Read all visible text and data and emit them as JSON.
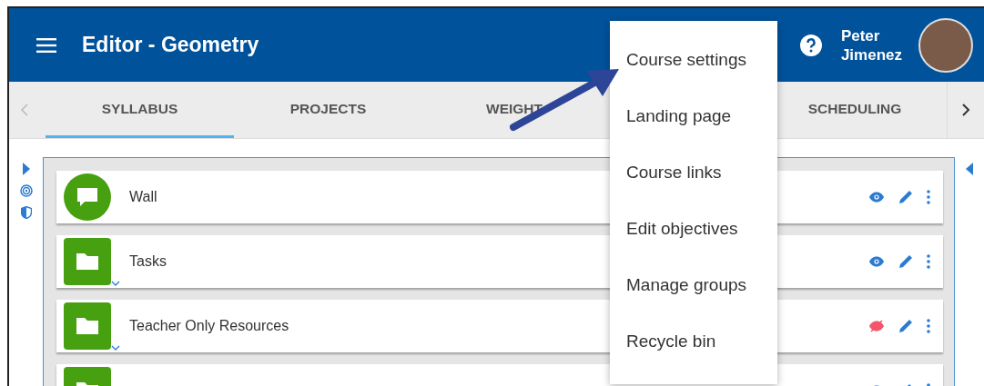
{
  "header": {
    "title": "Editor - Geometry",
    "user": {
      "first_name": "Peter",
      "last_name": "Jimenez"
    }
  },
  "tabs": [
    {
      "label": "SYLLABUS",
      "selected": true
    },
    {
      "label": "PROJECTS",
      "selected": false
    },
    {
      "label": "WEIGHT",
      "selected": false
    },
    {
      "label": "SCHEDULING",
      "selected": false
    }
  ],
  "items": [
    {
      "kind": "wall",
      "title": "Wall",
      "visible": true,
      "expandable": false
    },
    {
      "kind": "folder",
      "title": "Tasks",
      "visible": true,
      "expandable": true
    },
    {
      "kind": "folder",
      "title": "Teacher Only Resources",
      "visible": false,
      "expandable": true
    },
    {
      "kind": "folder",
      "visible": true
    }
  ],
  "menu": {
    "items": [
      "Course settings",
      "Landing page",
      "Course links",
      "Edit objectives",
      "Manage groups",
      "Recycle bin"
    ]
  }
}
